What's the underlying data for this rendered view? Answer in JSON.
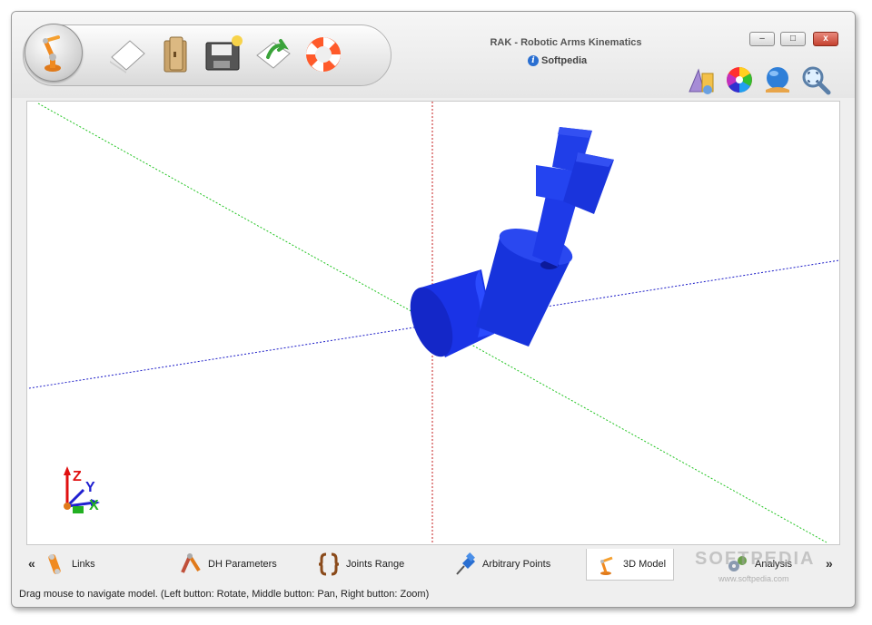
{
  "window": {
    "title": "RAK - Robotic Arms Kinematics",
    "brand": "Softpedia",
    "buttons": {
      "minimize": "–",
      "maximize": "□",
      "close": "x"
    }
  },
  "toolbar": {
    "items": [
      "home-icon",
      "new-file-icon",
      "open-folder-icon",
      "save-icon",
      "export-icon",
      "help-lifebuoy-icon"
    ]
  },
  "view_tools": [
    "shapes-icon",
    "color-wheel-icon",
    "globe-icon",
    "zoom-fit-icon"
  ],
  "viewport": {
    "axis_labels": {
      "z": "Z",
      "y": "Y",
      "x": "X"
    },
    "colors": {
      "x_axis": "#1e1ec8",
      "y_axis": "#22c422",
      "z_axis": "#c41e1e",
      "arm": "#1a33e6"
    }
  },
  "tabs": {
    "prev": "«",
    "next": "»",
    "items": [
      {
        "label": "Links",
        "icon": "links-icon"
      },
      {
        "label": "DH Parameters",
        "icon": "dh-parameters-icon"
      },
      {
        "label": "Joints Range",
        "icon": "joints-range-icon"
      },
      {
        "label": "Arbitrary Points",
        "icon": "pushpin-icon"
      },
      {
        "label": "3D Model",
        "icon": "robot-arm-icon",
        "active": true
      },
      {
        "label": "Analysis",
        "icon": "analysis-icon"
      }
    ]
  },
  "status": "Drag mouse to navigate model. (Left button: Rotate, Middle button: Pan, Right button: Zoom)",
  "watermark": {
    "main": "SOFTPEDIA",
    "sub": "www.softpedia.com"
  }
}
